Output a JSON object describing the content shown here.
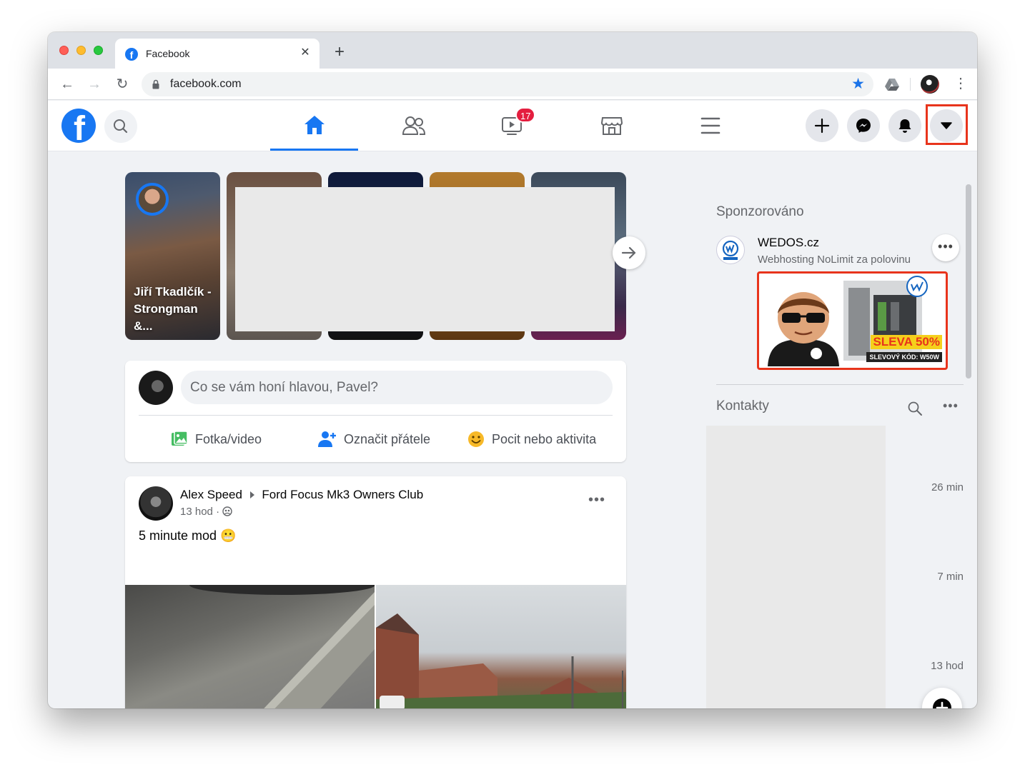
{
  "browser": {
    "tab_title": "Facebook",
    "tab_favicon": "f",
    "tab_close": "✕",
    "new_tab": "+",
    "back_icon": "←",
    "forward_icon": "→",
    "reload_icon": "↻",
    "url": "facebook.com",
    "bookmark_star": "★",
    "menu_icon": "⋮",
    "accent_color": "#1a73e8"
  },
  "header": {
    "logo_letter": "f",
    "nav": {
      "watch_badge": "17"
    },
    "icons": [
      "home-icon",
      "friends-icon",
      "watch-icon",
      "marketplace-icon",
      "menu-icon",
      "plus-icon",
      "messenger-icon",
      "bell-icon",
      "caret-down-icon"
    ],
    "brand_color": "#1877f2",
    "badge_color": "#e41e3f"
  },
  "stories": {
    "first_story_name": "Jiří Tkadlčík - Strongman &...",
    "next_icon": "arrow-right-icon"
  },
  "composer": {
    "placeholder": "Co se vám honí hlavou, Pavel?",
    "actions": [
      {
        "label": "Fotka/video",
        "icon": "photo-icon",
        "color": "#45bd62"
      },
      {
        "label": "Označit přátele",
        "icon": "tag-friends-icon",
        "color": "#1877f2"
      },
      {
        "label": "Pocit nebo aktivita",
        "icon": "smiley-icon",
        "color": "#f7b928"
      }
    ]
  },
  "post": {
    "author": "Alex Speed",
    "group": "Ford Focus Mk3 Owners Club",
    "time": "13 hod",
    "meta_sep": "·",
    "text": "5 minute mod 😬",
    "more": "•••"
  },
  "sidebar": {
    "sponsored_title": "Sponzorováno",
    "ad": {
      "name": "WEDOS.cz",
      "subtitle": "Webhosting NoLimit za polovinu",
      "banner_discount": "SLEVA 50%",
      "banner_code": "SLEVOVÝ KÓD: W50W",
      "logo_text": "WEDOS",
      "more": "•••"
    },
    "contacts_title": "Kontakty",
    "contacts_more": "•••",
    "contact_times": [
      "26 min",
      "7 min",
      "13 hod"
    ]
  },
  "highlight_color": "#e8341c"
}
